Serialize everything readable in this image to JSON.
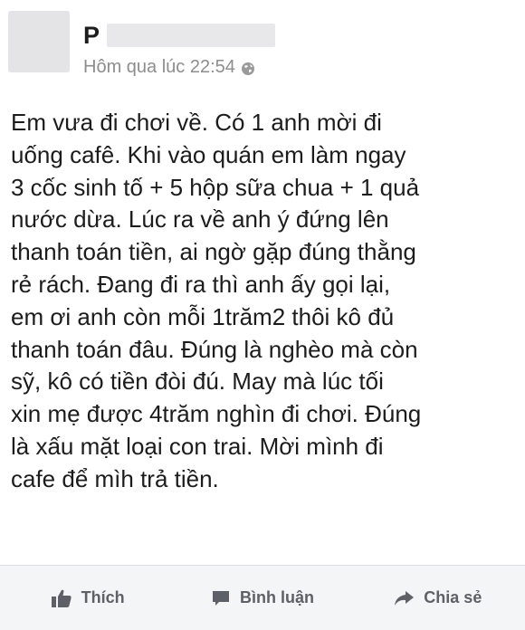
{
  "post": {
    "author_name": "P",
    "timestamp": "Hôm qua lúc 22:54",
    "privacy_icon": "globe-icon",
    "body_lines": [
      "Em vưa đi chơi về. Có 1 anh mời đi",
      "uống cafê. Khi vào quán em làm ngay",
      "3 cốc sinh tố + 5 hộp sữa chua + 1 quả",
      "nước dừa. Lúc ra về anh ý đứng lên",
      "thanh toán tiền, ai ngờ gặp đúng thằng",
      "rẻ rách. Đang đi ra thì anh ấy gọi lại,",
      "em ơi anh còn mỗi 1trăm2 thôi kô đủ",
      "thanh toán đâu. Đúng là nghèo mà còn",
      "sỹ, kô có tiền đòi đú. May mà lúc tối",
      "xin mẹ được 4trăm nghìn đi chơi. Đúng",
      "là xấu mặt loại con trai. Mời mình đi",
      "cafe để mìh trả tiền."
    ]
  },
  "actions": {
    "like": {
      "label": "Thích",
      "icon": "thumbs-up-icon"
    },
    "comment": {
      "label": "Bình luận",
      "icon": "comment-bubble-icon"
    },
    "share": {
      "label": "Chia sẻ",
      "icon": "share-arrow-icon"
    }
  }
}
